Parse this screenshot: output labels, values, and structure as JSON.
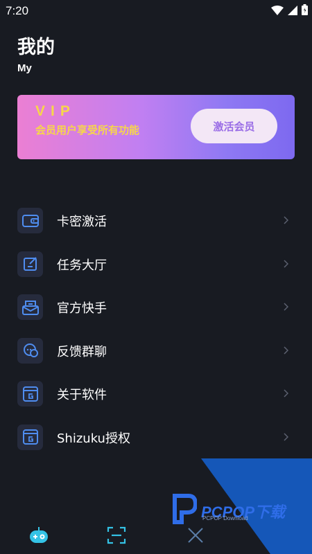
{
  "status_bar": {
    "time": "7:20",
    "icons": [
      "wifi-icon",
      "signal-icon",
      "battery-icon"
    ]
  },
  "header": {
    "title": "我的",
    "subtitle": "My"
  },
  "vip_card": {
    "title": "VIP",
    "description": "会员用户享受所有功能",
    "button_label": "激活会员",
    "colors": {
      "gradient_start": "#eb7fd3",
      "gradient_end": "#7d69f0",
      "text": "#f7d64a"
    }
  },
  "menu": {
    "items": [
      {
        "label": "卡密激活",
        "icon": "wallet-icon"
      },
      {
        "label": "任务大厅",
        "icon": "task-edit-icon"
      },
      {
        "label": "官方快手",
        "icon": "inbox-icon"
      },
      {
        "label": "反馈群聊",
        "icon": "chat-icon"
      },
      {
        "label": "关于软件",
        "icon": "app-g-icon"
      },
      {
        "label": "Shizuku授权",
        "icon": "app-g-icon"
      }
    ]
  },
  "watermark": {
    "text": "PCPOP下载",
    "subtext": "PCPOP Download"
  },
  "bottom_nav": {
    "items": [
      "gamepad-icon",
      "scan-icon",
      "close-x-icon"
    ]
  },
  "colors": {
    "background": "#181b22",
    "icon_bg": "#262b3d",
    "icon_accent": "#4f8df0"
  }
}
